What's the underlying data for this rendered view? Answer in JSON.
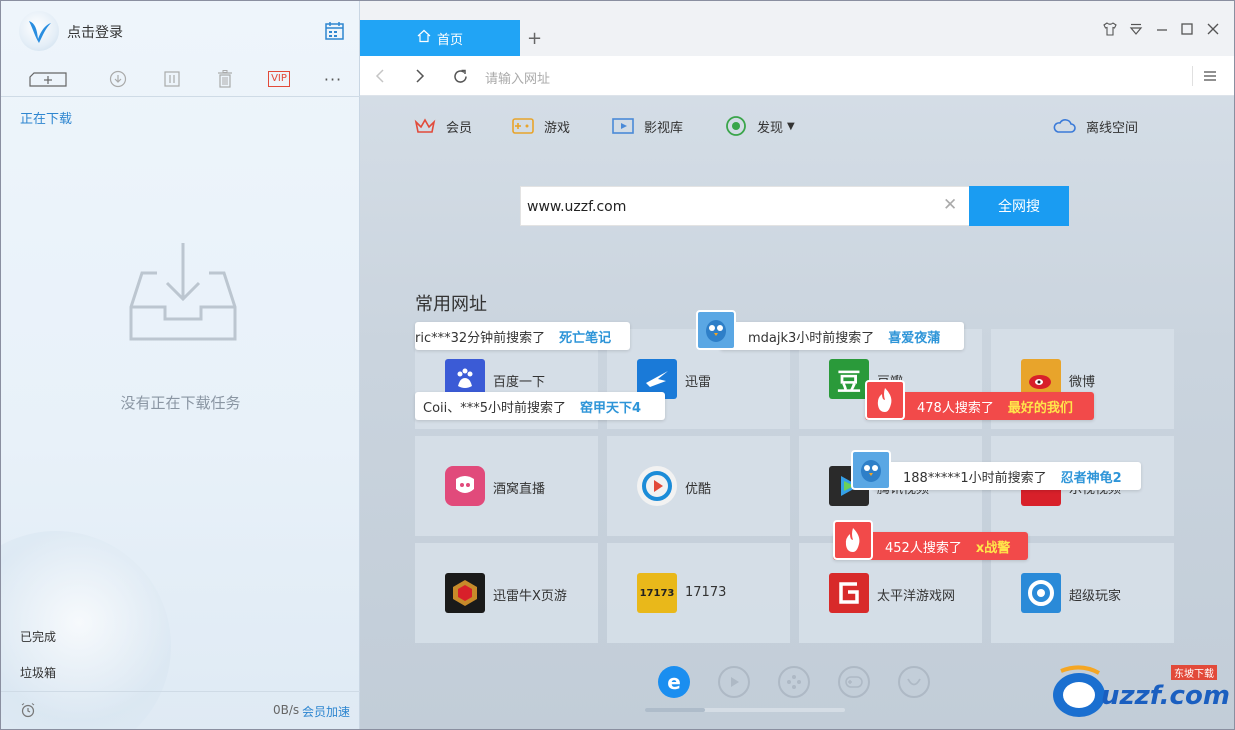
{
  "left": {
    "login_label": "点击登录",
    "downloading_label": "正在下载",
    "empty_text": "没有正在下载任务",
    "completed_label": "已完成",
    "trash_label": "垃圾箱",
    "speed": "0B/s",
    "vip_speed_label": "会员加速",
    "toolbar_icons": [
      "new-task-icon",
      "download-icon",
      "pause-icon",
      "delete-icon",
      "vip-icon",
      "more-icon"
    ],
    "vip_text": "VIP",
    "more_text": "···"
  },
  "tabs": [
    {
      "label": "首页",
      "active": true
    }
  ],
  "address": {
    "placeholder": "请输入网址"
  },
  "nav": {
    "member": "会员",
    "games": "游戏",
    "video": "影视库",
    "discover": "发现",
    "cloud": "离线空间"
  },
  "search": {
    "value": "www.uzzf.com",
    "button": "全网搜",
    "clear": "✕"
  },
  "common_title": "常用网址",
  "sites": [
    {
      "label": "百度一下",
      "color": "#3b5bd6"
    },
    {
      "label": "迅雷",
      "color": "#1a7ad8"
    },
    {
      "label": "豆瓣",
      "color": "#2a9a3a"
    },
    {
      "label": "微博",
      "color": "#e8a42b"
    },
    {
      "label": "酒窝直播",
      "color": "#e14a7b"
    },
    {
      "label": "优酷",
      "color": "#1c8cd8"
    },
    {
      "label": "腾讯视频",
      "color": "#2a2a2a"
    },
    {
      "label": "乐视视频",
      "color": "#d8202a"
    },
    {
      "label": "迅雷牛X页游",
      "color": "#1a1a1a"
    },
    {
      "label": "17173",
      "color": "#e9b81a"
    },
    {
      "label": "太平洋游戏网",
      "color": "#d82a2a"
    },
    {
      "label": "超级玩家",
      "color": "#2a8ad8"
    }
  ],
  "bubbles": [
    {
      "text": "ric***32分钟前搜索了",
      "hot": "死亡笔记",
      "red": false
    },
    {
      "text": "mdajk3小时前搜索了",
      "hot": "喜爱夜蒲",
      "red": false
    },
    {
      "text": "Coii、***5小时前搜索了",
      "hot": "窑甲天下4",
      "red": false
    },
    {
      "text": "478人搜索了",
      "hot": "最好的我们",
      "red": true
    },
    {
      "text": "188*****1小时前搜索了",
      "hot": "忍者神龟2",
      "red": false
    },
    {
      "text": "452人搜索了",
      "hot": "x战警",
      "red": true
    }
  ],
  "watermark": {
    "text": "uzzf.com",
    "sub": "东坡下载"
  },
  "colors": {
    "accent": "#21a4f5",
    "search_button": "#1a9cf2",
    "hot_red": "#f24a4a"
  }
}
